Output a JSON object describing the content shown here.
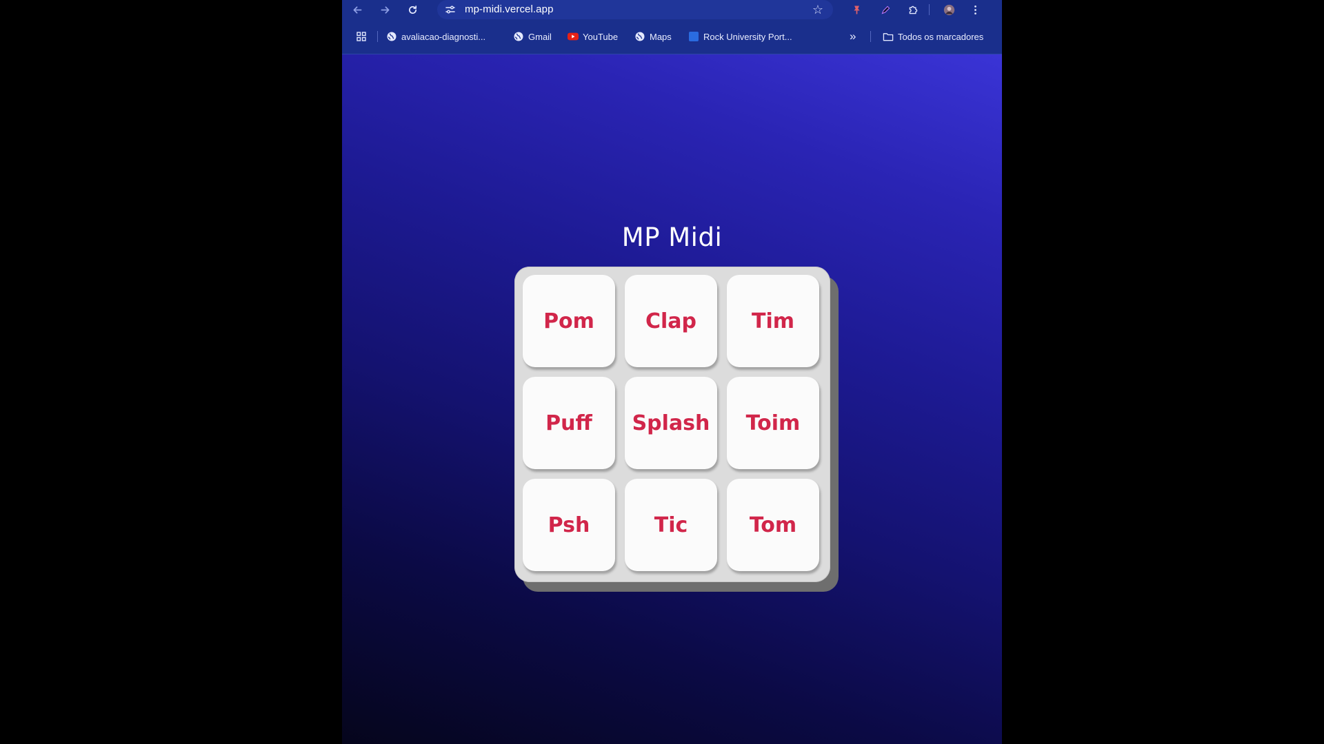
{
  "browser": {
    "url": "mp-midi.vercel.app",
    "bookmarks": [
      {
        "label": "avaliacao-diagnosti...",
        "icon": "globe-icon"
      },
      {
        "label": "Gmail",
        "icon": "globe-icon"
      },
      {
        "label": "YouTube",
        "icon": "youtube-icon"
      },
      {
        "label": "Maps",
        "icon": "globe-icon"
      },
      {
        "label": "Rock University Port...",
        "icon": "bookmark-square-icon"
      }
    ],
    "overflow_label": "»",
    "all_bookmarks_label": "Todos os marcadores",
    "colors": {
      "toolbar": "#1a2f8c",
      "youtube_red": "#e62117"
    }
  },
  "page": {
    "title": "MP Midi",
    "pads": [
      {
        "label": "Pom"
      },
      {
        "label": "Clap"
      },
      {
        "label": "Tim"
      },
      {
        "label": "Puff"
      },
      {
        "label": "Splash"
      },
      {
        "label": "Toim"
      },
      {
        "label": "Psh"
      },
      {
        "label": "Tic"
      },
      {
        "label": "Tom"
      }
    ],
    "colors": {
      "pad_text": "#d1264a",
      "pad_bg": "#fbfbfb",
      "board_bg": "#dcdcdc"
    }
  }
}
